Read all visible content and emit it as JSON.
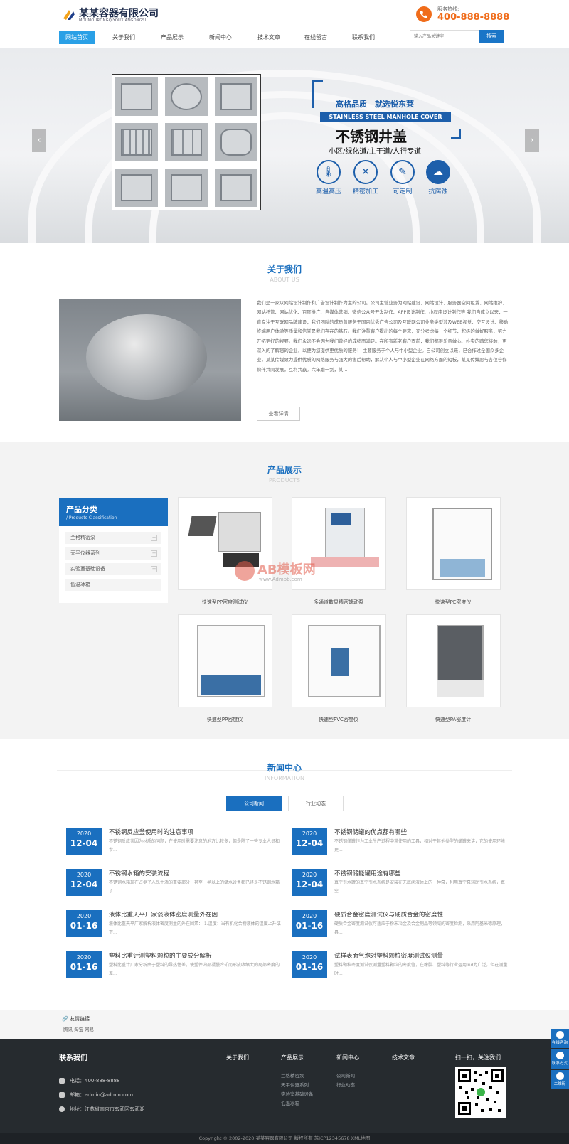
{
  "header": {
    "company_name": "某某容器有限公司",
    "company_pinyin": "MOUMOURONGQIYOUXIANGONGSI",
    "hotline_label": "服务热线:",
    "hotline_number": "400-888-8888",
    "nav": [
      "网站首页",
      "关于我们",
      "产品展示",
      "新闻中心",
      "技术文章",
      "在线留言",
      "联系我们"
    ],
    "search_placeholder": "输入产品关键字",
    "search_button": "搜索"
  },
  "banner": {
    "slogan": "高格品质　就选悦东莱",
    "english": "STAINLESS STEEL MANHOLE COVER",
    "title": "不锈钢井盖",
    "subtitle": "小区/绿化道/主干道/人行专道",
    "features": [
      "高温高压",
      "精密加工",
      "可定制",
      "抗腐蚀"
    ],
    "prev_arrow": "‹",
    "next_arrow": "›"
  },
  "about": {
    "title": "关于我们",
    "subtitle": "ABOUT US",
    "text": "我们是一家以网站设计制作和广告设计制作为主的公司。公司主营业务为网站建设、网站设计、服务器空间租赁、网站维护、网站托管、网站优化、百度推广、自媒体营销、微信公众号开发制作、APP设计制作、小程序设计制作等 我们自成立以来，一直专注于互联网品牌建设，我们团队的成员曾服务于国内优秀广告公司及互联网公司业务类型涉及WEB视觉、交互设计、移动终端用户体验等质量和信誉是我们存在的基石。我们注重客户提出的每个要求，充分考虑每一个细节，积极的做好服务，努力开拓更好的视野。我们永远不会因为我们曾经的成绩而满足。在所有新老客户面前，我们都很乐意做心、朴实的踏您接触，更深入的了解您的企业，以便为您提供更优质的服务！ 主要服务于个人与中小型企业。自公司创立以来，已合作过全国众多企业，某某传媒致力提供优质的网络服务与强大的售后帮助，解决个人与中小型企业在网络方面的短板，某某传媒愿与各位合作伙伴共同发展，互利共赢。六年磨一剑，某...",
    "button": "查看详情"
  },
  "products": {
    "title": "产品展示",
    "subtitle": "PRODUCTS",
    "category_title": "产品分类",
    "category_subtitle": "/ Products Classification",
    "categories": [
      "兰格精密泵",
      "天平仪器系列",
      "实验室基础设备",
      "低温冰箱"
    ],
    "items": [
      "快速型PP密度测试仪",
      "多通道数显精密蠕动泵",
      "快速型PE密度仪",
      "快速型PP密度仪",
      "快速型PVC密度仪",
      "快速型PA密度计"
    ],
    "watermark": "AB模板网",
    "watermark_url": "www.Admbb.com"
  },
  "news": {
    "title": "新闻中心",
    "subtitle": "INFORMATION",
    "tabs": [
      "公司新闻",
      "行业动态"
    ],
    "left": [
      {
        "year": "2020",
        "md": "12-04",
        "title": "不锈钢反应釜使用时的注意事项",
        "desc": "不锈钢反应釜因为材质的问题，在使用时需要注意的地方比较多，但是除了一些专业人员和参..."
      },
      {
        "year": "2020",
        "md": "12-04",
        "title": "不锈钢水箱的安装流程",
        "desc": "不锈钢水箱现在占据了人民生活的重要部分，甚至一半以上的储水设备都已经是不锈钢水箱了..."
      },
      {
        "year": "2020",
        "md": "01-16",
        "title": "液体比重天平厂家谈液体密度测量外在因",
        "desc": "液体比重天平厂家解析液体密度测量的外在因素： 1.温度：当有机化合物液体的温度上升或下..."
      },
      {
        "year": "2020",
        "md": "01-16",
        "title": "塑料比重计测塑料颗粒的主要成分解析",
        "desc": "塑料比重计厂家分析由于塑料的导热性差，使塑件内部凝慢冷却而形成收缩大的局部密度的差..."
      }
    ],
    "right": [
      {
        "year": "2020",
        "md": "12-04",
        "title": "不锈钢储罐的优点都有哪些",
        "desc": "不锈钢储罐作为工业生产过程中常使用的工具，相对于其他类型的储罐来讲，它的使用环境更..."
      },
      {
        "year": "2020",
        "md": "12-04",
        "title": "不锈钢储能罐用途有哪些",
        "desc": "真空引水罐的真空引水系统是安装在无底阀液体上的一种泵，利用真空泵辅助引水系统，真空..."
      },
      {
        "year": "2020",
        "md": "01-16",
        "title": "硬质合金密度测试仪与硬质合金的密度性",
        "desc": "硬质合金密度测试仪可适应于粉末冶金及合金制品等领域的密度检测，采用阿基米德原理，具..."
      },
      {
        "year": "2020",
        "md": "01-16",
        "title": "试样表面气泡对塑料颗粒密度测试仪测量",
        "desc": "塑料颗粒密度测试仪测量塑料颗粒的密度值，在橡胶、塑料等行业运用Ind为广泛，但在测量时..."
      }
    ]
  },
  "links": {
    "title": "友情链接",
    "items": "腾讯 淘宝 网易"
  },
  "footer": {
    "contact_title": "联系我们",
    "phone": "电话：400-888-8888",
    "email": "邮箱：admin@admin.com",
    "address": "地址：江苏省南京市玄武区玄武湖",
    "cols": [
      {
        "title": "关于我们",
        "items": []
      },
      {
        "title": "产品展示",
        "items": [
          "兰格精密泵",
          "天平仪器系列",
          "实验室基础设备",
          "低温冰箱"
        ]
      },
      {
        "title": "新闻中心",
        "items": [
          "公司新闻",
          "行业动态"
        ]
      },
      {
        "title": "技术文章",
        "items": []
      }
    ],
    "qr_title": "扫一扫，关注我们",
    "copyright": "Copyright © 2002-2020 某某容器有限公司 版权所有  苏ICP12345678  XML地图"
  },
  "side": [
    "在线咨询",
    "联系方式",
    "二维码"
  ]
}
